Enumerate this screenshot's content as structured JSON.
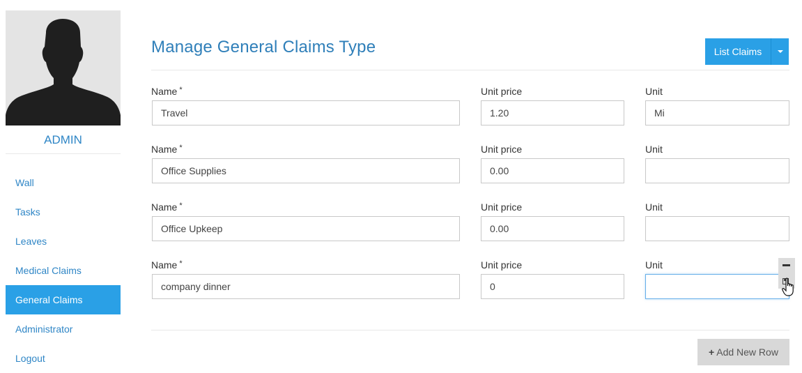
{
  "sidebar": {
    "username": "ADMIN",
    "items": [
      {
        "label": "Wall"
      },
      {
        "label": "Tasks"
      },
      {
        "label": "Leaves"
      },
      {
        "label": "Medical Claims"
      },
      {
        "label": "General Claims",
        "active": true
      },
      {
        "label": "Administrator"
      },
      {
        "label": "Logout"
      }
    ]
  },
  "header": {
    "title": "Manage General Claims Type",
    "list_button": "List Claims"
  },
  "form": {
    "labels": {
      "name": "Name",
      "required_mark": "*",
      "unit_price": "Unit price",
      "unit": "Unit"
    },
    "rows": [
      {
        "name": "Travel",
        "unit_price": "1.20",
        "unit": "Mi"
      },
      {
        "name": "Office Supplies",
        "unit_price": "0.00",
        "unit": ""
      },
      {
        "name": "Office Upkeep",
        "unit_price": "0.00",
        "unit": ""
      },
      {
        "name": "company dinner",
        "unit_price": "0",
        "unit": ""
      }
    ]
  },
  "footer": {
    "add_row_icon": "+",
    "add_row_label": "Add New Row"
  },
  "icons": {
    "avatar": "user-silhouette-icon",
    "caret": "caret-down-icon",
    "remove_row": "minus-icon",
    "save_row": "floppy-disk-icon",
    "cursor": "hand-pointer-cursor-icon",
    "add": "plus-icon"
  },
  "colors": {
    "accent": "#2aa0e6",
    "title": "#2f7fb9",
    "link": "#2f86c6",
    "avatar_bg": "#e4e4e4",
    "secondary_button": "#d8d8d8"
  }
}
